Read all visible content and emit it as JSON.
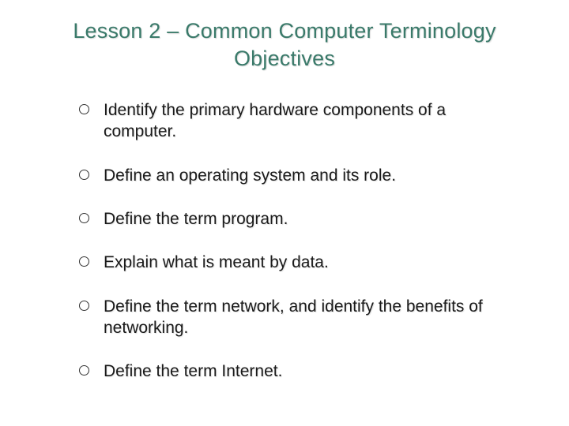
{
  "title": "Lesson 2 – Common Computer Terminology Objectives",
  "objectives": [
    "Identify the primary hardware components of a computer.",
    "Define an operating system and its role.",
    "Define the term program.",
    "Explain what is meant by data.",
    "Define the term network, and identify the benefits of networking.",
    "Define the term Internet."
  ]
}
